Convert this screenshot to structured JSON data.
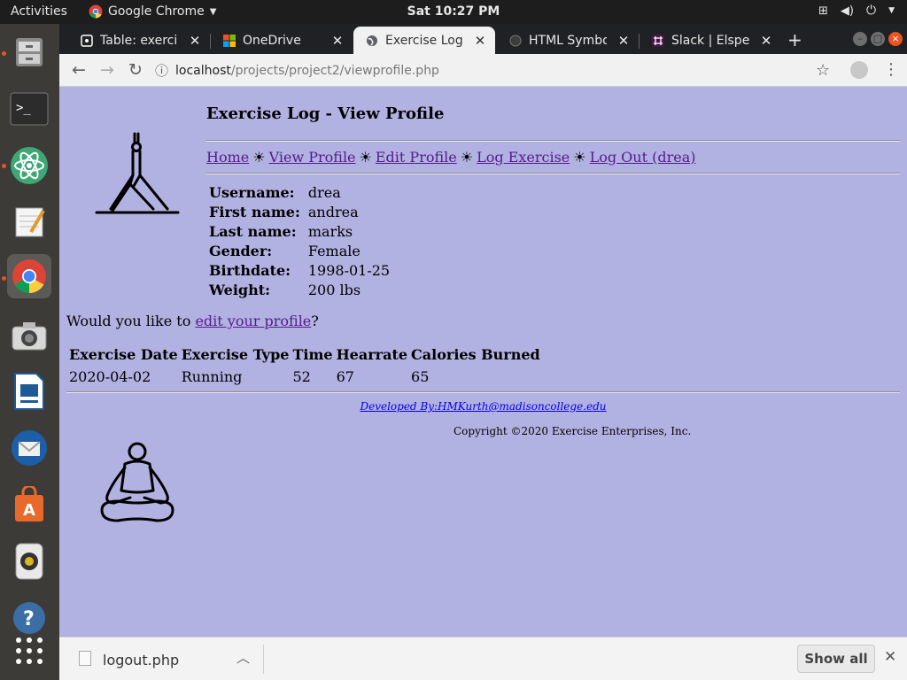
{
  "topbar": {
    "activities": "Activities",
    "app_name": "Google Chrome",
    "clock": "Sat 10:27 PM"
  },
  "dock": {
    "items": [
      "file-manager",
      "terminal",
      "atom",
      "text-editor",
      "chrome",
      "screenshot",
      "libreoffice-impress",
      "thunderbird",
      "software-center",
      "rhythmbox",
      "help",
      "show-applications"
    ]
  },
  "browser": {
    "tabs": [
      {
        "title": "Table: exercise",
        "icon": "page-icon"
      },
      {
        "title": "OneDrive",
        "icon": "microsoft-icon"
      },
      {
        "title": "Exercise Log - ",
        "icon": "globe-icon"
      },
      {
        "title": "HTML Symbol",
        "icon": "symbol-icon"
      },
      {
        "title": "Slack | Elspeth",
        "icon": "slack-icon"
      }
    ],
    "url_host": "localhost",
    "url_path": "/projects/project2/viewprofile.php"
  },
  "page": {
    "title": "Exercise Log - View Profile",
    "nav": [
      {
        "label": "Home"
      },
      {
        "label": "View Profile"
      },
      {
        "label": "Edit Profile"
      },
      {
        "label": "Log Exercise"
      },
      {
        "label": "Log Out (drea)"
      }
    ],
    "nav_separator": "☀",
    "profile": [
      {
        "label": "Username:",
        "value": "drea"
      },
      {
        "label": "First name:",
        "value": "andrea"
      },
      {
        "label": "Last name:",
        "value": "marks"
      },
      {
        "label": "Gender:",
        "value": "Female"
      },
      {
        "label": "Birthdate:",
        "value": "1998-01-25"
      },
      {
        "label": "Weight:",
        "value": "200 lbs"
      }
    ],
    "edit_prompt_prefix": "Would you like to ",
    "edit_link": "edit your profile",
    "edit_prompt_suffix": "?",
    "exercise_table": {
      "headers": [
        "Exercise Date",
        "Exercise Type",
        "Time",
        "Hearrate",
        "Calories Burned"
      ],
      "rows": [
        [
          "2020-04-02",
          "Running",
          "52",
          "67",
          "65"
        ]
      ]
    },
    "developer": "Developed By:HMKurth@madisoncollege.edu",
    "copyright": "Copyright ©2020 Exercise Enterprises, Inc."
  },
  "downloads": {
    "file": "logout.php",
    "show_all": "Show all"
  }
}
